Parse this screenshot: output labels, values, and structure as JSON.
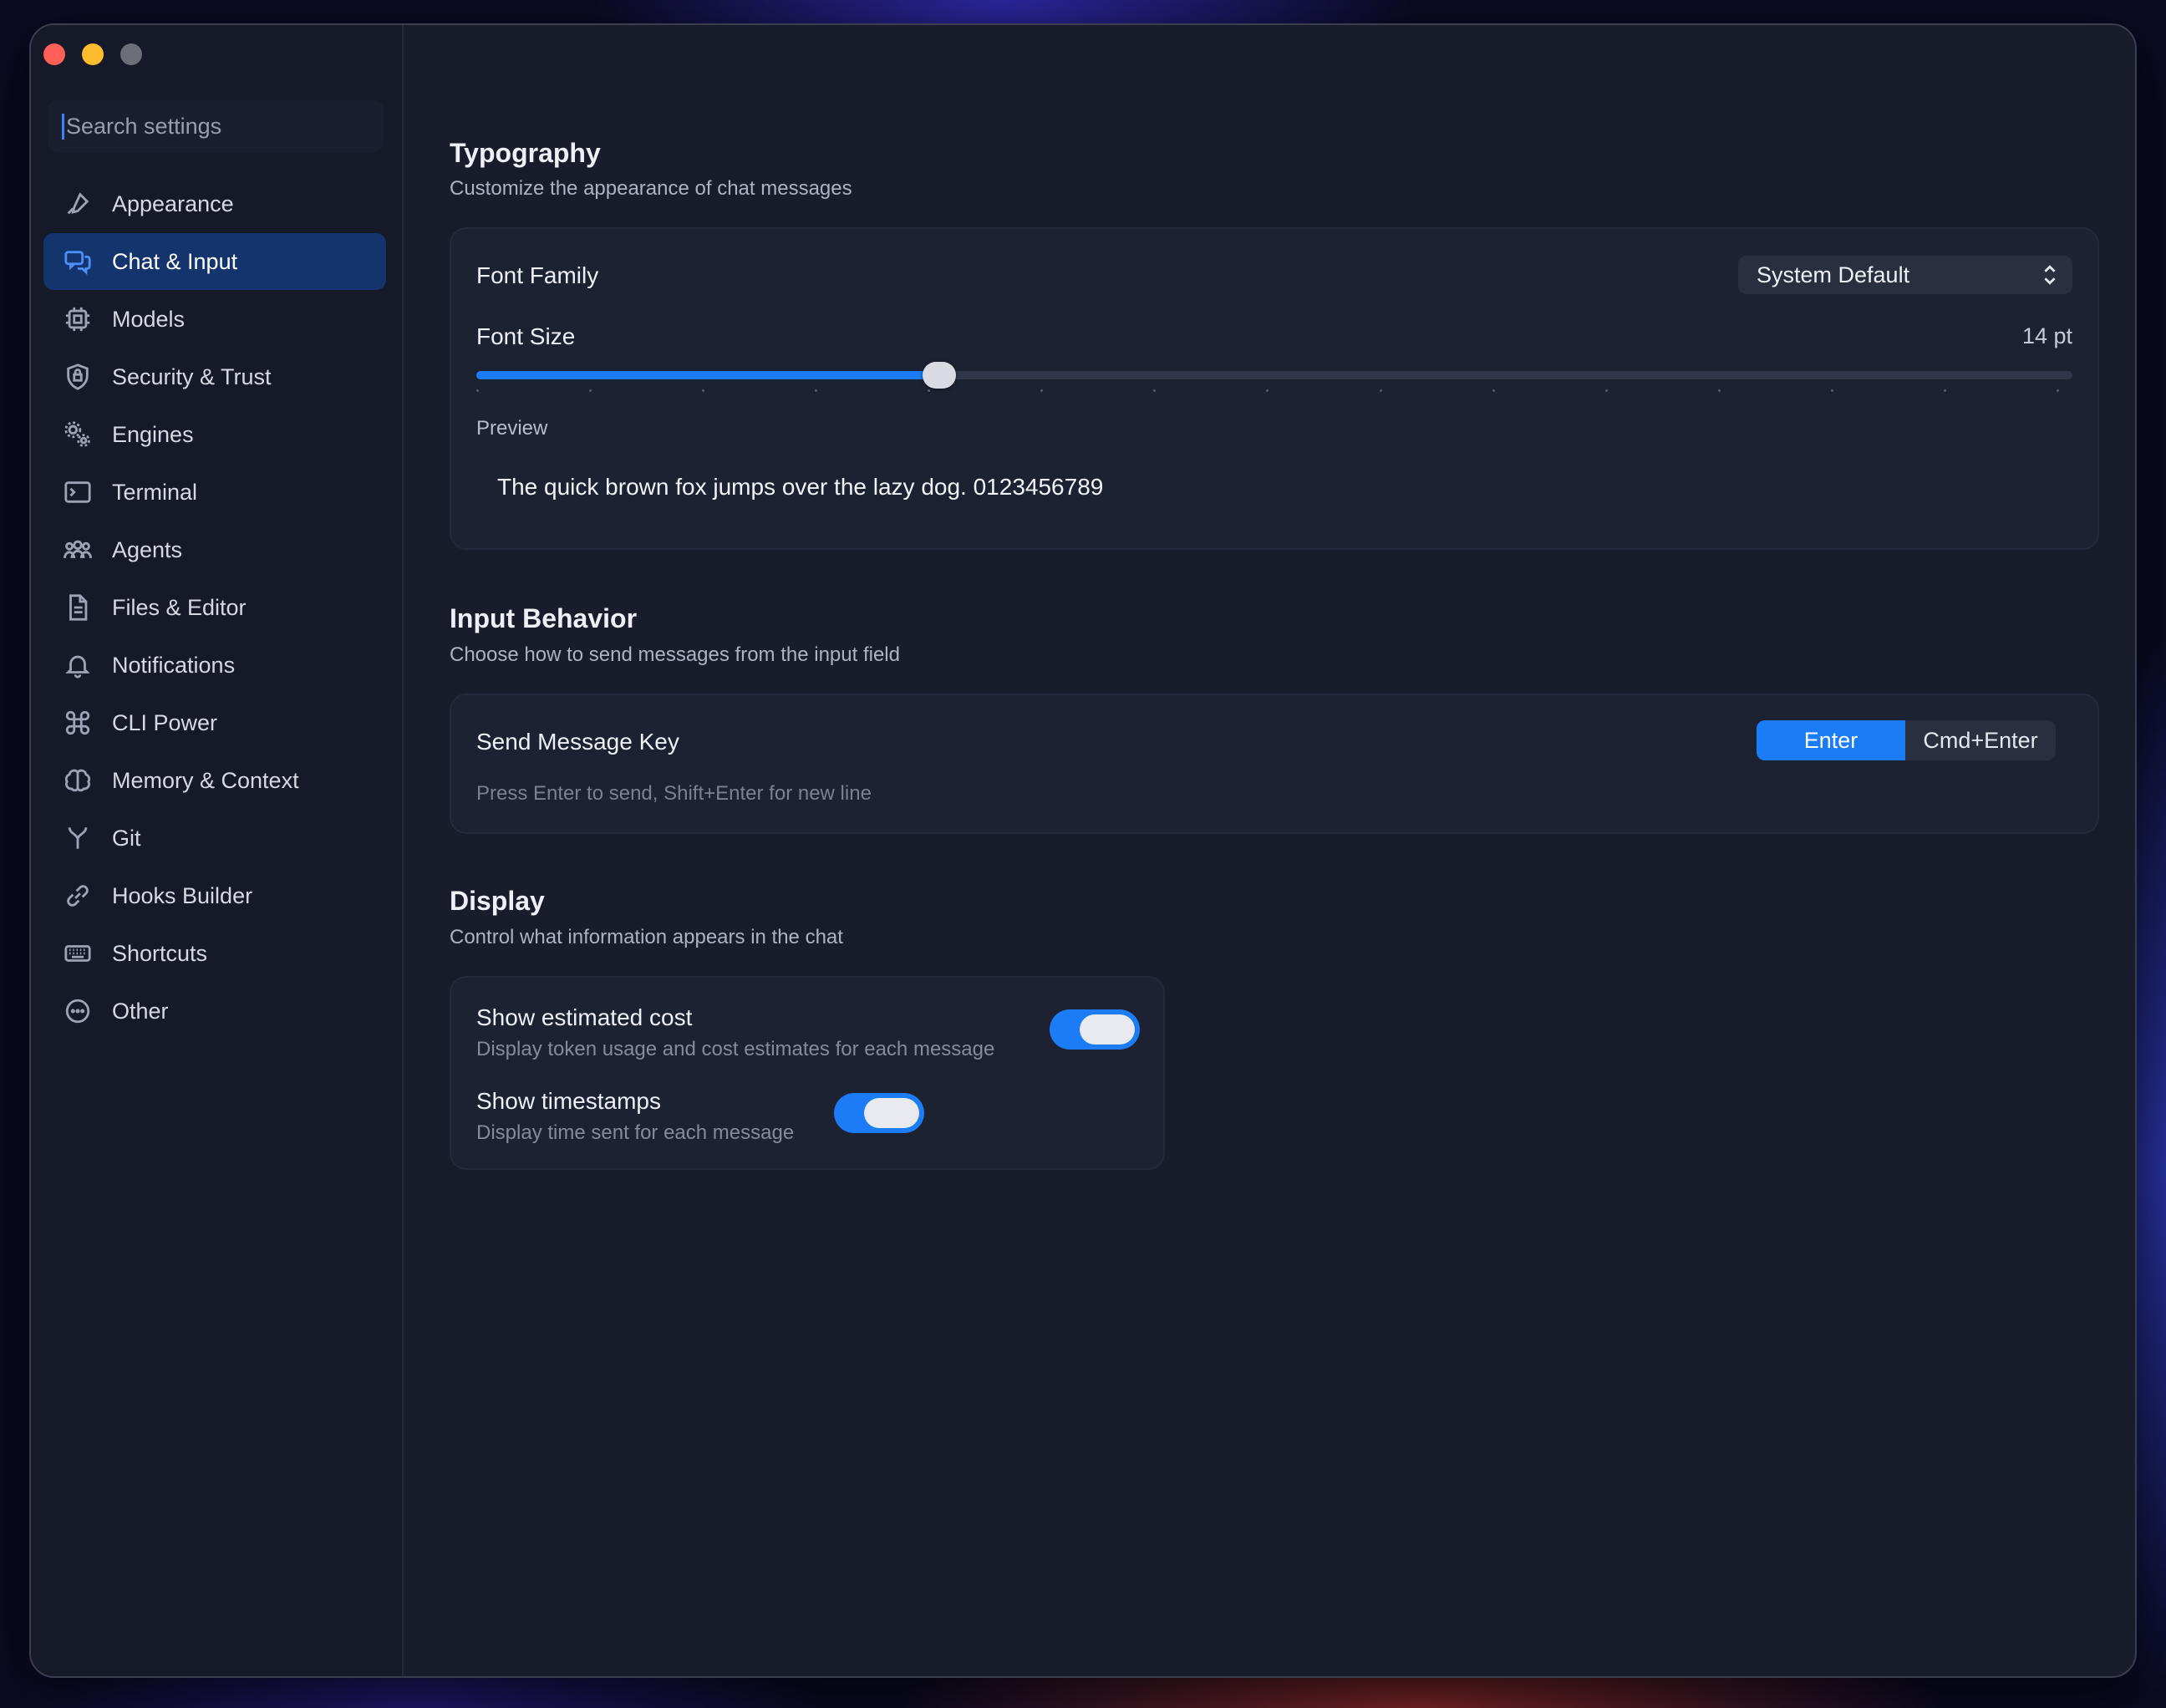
{
  "window": {
    "traffic_lights": [
      "close",
      "minimize",
      "zoom"
    ]
  },
  "sidebar": {
    "search_placeholder": "Search settings",
    "items": [
      {
        "label": "Appearance",
        "icon": "brush-icon",
        "active": false
      },
      {
        "label": "Chat & Input",
        "icon": "chat-bubbles-icon",
        "active": true
      },
      {
        "label": "Models",
        "icon": "cpu-icon",
        "active": false
      },
      {
        "label": "Security & Trust",
        "icon": "shield-icon",
        "active": false
      },
      {
        "label": "Engines",
        "icon": "gears-icon",
        "active": false
      },
      {
        "label": "Terminal",
        "icon": "terminal-icon",
        "active": false
      },
      {
        "label": "Agents",
        "icon": "people-icon",
        "active": false
      },
      {
        "label": "Files & Editor",
        "icon": "document-icon",
        "active": false
      },
      {
        "label": "Notifications",
        "icon": "bell-icon",
        "active": false
      },
      {
        "label": "CLI Power",
        "icon": "command-icon",
        "active": false
      },
      {
        "label": "Memory & Context",
        "icon": "brain-icon",
        "active": false
      },
      {
        "label": "Git",
        "icon": "git-branch-icon",
        "active": false
      },
      {
        "label": "Hooks Builder",
        "icon": "link-icon",
        "active": false
      },
      {
        "label": "Shortcuts",
        "icon": "keyboard-icon",
        "active": false
      },
      {
        "label": "Other",
        "icon": "ellipsis-circle-icon",
        "active": false
      }
    ]
  },
  "typography": {
    "title": "Typography",
    "subtitle": "Customize the appearance of chat messages",
    "font_family_label": "Font Family",
    "font_family_value": "System Default",
    "font_size_label": "Font Size",
    "font_size_value": "14 pt",
    "font_size_slider_fraction": 0.29,
    "slider_tick_count": 15,
    "preview_label": "Preview",
    "preview_text": "The quick brown fox jumps over the lazy dog. 0123456789"
  },
  "input_behavior": {
    "title": "Input Behavior",
    "subtitle": "Choose how to send messages from the input field",
    "send_key_label": "Send Message Key",
    "options": [
      "Enter",
      "Cmd+Enter"
    ],
    "selected": "Enter",
    "hint": "Press Enter to send, Shift+Enter for new line"
  },
  "display": {
    "title": "Display",
    "subtitle": "Control what information appears in the chat",
    "show_cost_title": "Show estimated cost",
    "show_cost_desc": "Display token usage and cost estimates for each message",
    "show_cost_on": true,
    "show_timestamps_title": "Show timestamps",
    "show_timestamps_desc": "Display time sent for each message",
    "show_timestamps_on": true
  },
  "colors": {
    "accent": "#1b7cf5",
    "active_nav_bg": "#14346e",
    "window_bg": "#181c2b",
    "sidebar_bg": "#151928"
  }
}
